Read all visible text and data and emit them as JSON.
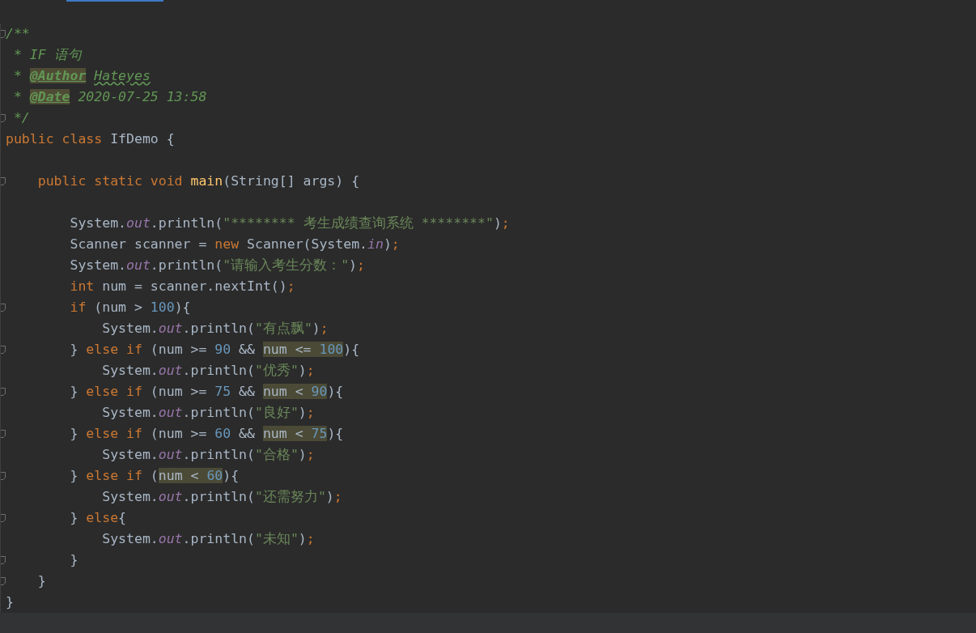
{
  "editor": {
    "lines": [
      {
        "fold": true,
        "tokens": [
          {
            "kind": "comment",
            "text": "/**"
          }
        ]
      },
      {
        "fold": false,
        "tokens": [
          {
            "kind": "comment",
            "text": " * IF 语句"
          }
        ]
      },
      {
        "fold": false,
        "tokens": [
          {
            "kind": "comment",
            "text": " * "
          },
          {
            "kind": "doc-tag",
            "text": "@Author"
          },
          {
            "kind": "doc-name",
            "text": "Hateyes"
          }
        ]
      },
      {
        "fold": false,
        "tokens": [
          {
            "kind": "comment",
            "text": " * "
          },
          {
            "kind": "doc-tag",
            "text": "@Date"
          },
          {
            "kind": "comment",
            "text": " 2020-07-25 13:58"
          }
        ]
      },
      {
        "fold": true,
        "tokens": [
          {
            "kind": "comment",
            "text": " */"
          }
        ]
      },
      {
        "fold": false,
        "tokens": [
          {
            "kind": "keyword",
            "text": "public class "
          },
          {
            "kind": "plain",
            "text": "IfDemo {"
          }
        ]
      },
      {
        "fold": false
      },
      {
        "fold": true,
        "tokens": [
          {
            "kind": "keyword",
            "text": "    public static void "
          },
          {
            "kind": "method",
            "text": "main"
          },
          {
            "kind": "plain",
            "text": "(String[] args) {"
          }
        ]
      },
      {
        "fold": false
      },
      {
        "fold": false,
        "tokens": [
          {
            "kind": "plain",
            "text": "        System."
          },
          {
            "kind": "field",
            "text": "out"
          },
          {
            "kind": "plain",
            "text": ".println("
          },
          {
            "kind": "string",
            "text": "\"******** 考生成绩查询系统 ********\""
          },
          {
            "kind": "plain",
            "text": ")"
          },
          {
            "kind": "semicolon",
            "text": ";"
          }
        ]
      },
      {
        "fold": false,
        "tokens": [
          {
            "kind": "plain",
            "text": "        Scanner scanner = "
          },
          {
            "kind": "keyword",
            "text": "new "
          },
          {
            "kind": "plain",
            "text": "Scanner(System."
          },
          {
            "kind": "field",
            "text": "in"
          },
          {
            "kind": "plain",
            "text": ")"
          },
          {
            "kind": "semicolon",
            "text": ";"
          }
        ]
      },
      {
        "fold": false,
        "tokens": [
          {
            "kind": "plain",
            "text": "        System."
          },
          {
            "kind": "field",
            "text": "out"
          },
          {
            "kind": "plain",
            "text": ".println("
          },
          {
            "kind": "string",
            "text": "\"请输入考生分数：\""
          },
          {
            "kind": "plain",
            "text": ")"
          },
          {
            "kind": "semicolon",
            "text": ";"
          }
        ]
      },
      {
        "fold": false,
        "tokens": [
          {
            "kind": "keyword",
            "text": "        int "
          },
          {
            "kind": "plain",
            "text": "num = scanner.nextInt()"
          },
          {
            "kind": "semicolon",
            "text": ";"
          }
        ]
      },
      {
        "fold": true,
        "tokens": [
          {
            "kind": "keyword",
            "text": "        if "
          },
          {
            "kind": "plain",
            "text": "(num > "
          },
          {
            "kind": "number",
            "text": "100"
          },
          {
            "kind": "plain",
            "text": "){"
          }
        ]
      },
      {
        "fold": false,
        "tokens": [
          {
            "kind": "plain",
            "text": "            System."
          },
          {
            "kind": "field",
            "text": "out"
          },
          {
            "kind": "plain",
            "text": ".println("
          },
          {
            "kind": "string",
            "text": "\"有点飘\""
          },
          {
            "kind": "plain",
            "text": ")"
          },
          {
            "kind": "semicolon",
            "text": ";"
          }
        ]
      },
      {
        "fold": true,
        "tokens": [
          {
            "kind": "plain",
            "text": "        } "
          },
          {
            "kind": "keyword",
            "text": "else if "
          },
          {
            "kind": "plain",
            "text": "(num >= "
          },
          {
            "kind": "number",
            "text": "90"
          },
          {
            "kind": "plain",
            "text": " && "
          },
          {
            "kind": "match",
            "tokens": [
              {
                "kind": "plain",
                "text": "num <= "
              },
              {
                "kind": "number",
                "text": "100"
              }
            ]
          },
          {
            "kind": "plain",
            "text": "){"
          }
        ]
      },
      {
        "fold": false,
        "tokens": [
          {
            "kind": "plain",
            "text": "            System."
          },
          {
            "kind": "field",
            "text": "out"
          },
          {
            "kind": "plain",
            "text": ".println("
          },
          {
            "kind": "string",
            "text": "\"优秀\""
          },
          {
            "kind": "plain",
            "text": ")"
          },
          {
            "kind": "semicolon",
            "text": ";"
          }
        ]
      },
      {
        "fold": true,
        "tokens": [
          {
            "kind": "plain",
            "text": "        } "
          },
          {
            "kind": "keyword",
            "text": "else if "
          },
          {
            "kind": "plain",
            "text": "(num >= "
          },
          {
            "kind": "number",
            "text": "75"
          },
          {
            "kind": "plain",
            "text": " && "
          },
          {
            "kind": "match",
            "tokens": [
              {
                "kind": "plain",
                "text": "num < "
              },
              {
                "kind": "number",
                "text": "90"
              }
            ]
          },
          {
            "kind": "plain",
            "text": "){"
          }
        ]
      },
      {
        "fold": false,
        "tokens": [
          {
            "kind": "plain",
            "text": "            System."
          },
          {
            "kind": "field",
            "text": "out"
          },
          {
            "kind": "plain",
            "text": ".println("
          },
          {
            "kind": "string",
            "text": "\"良好\""
          },
          {
            "kind": "plain",
            "text": ")"
          },
          {
            "kind": "semicolon",
            "text": ";"
          }
        ]
      },
      {
        "fold": true,
        "tokens": [
          {
            "kind": "plain",
            "text": "        } "
          },
          {
            "kind": "keyword",
            "text": "else if "
          },
          {
            "kind": "plain",
            "text": "(num >= "
          },
          {
            "kind": "number",
            "text": "60"
          },
          {
            "kind": "plain",
            "text": " && "
          },
          {
            "kind": "match",
            "tokens": [
              {
                "kind": "plain",
                "text": "num < "
              },
              {
                "kind": "number",
                "text": "75"
              }
            ]
          },
          {
            "kind": "plain",
            "text": "){"
          }
        ]
      },
      {
        "fold": false,
        "tokens": [
          {
            "kind": "plain",
            "text": "            System."
          },
          {
            "kind": "field",
            "text": "out"
          },
          {
            "kind": "plain",
            "text": ".println("
          },
          {
            "kind": "string",
            "text": "\"合格\""
          },
          {
            "kind": "plain",
            "text": ")"
          },
          {
            "kind": "semicolon",
            "text": ";"
          }
        ]
      },
      {
        "fold": true,
        "tokens": [
          {
            "kind": "plain",
            "text": "        } "
          },
          {
            "kind": "keyword",
            "text": "else if "
          },
          {
            "kind": "plain",
            "text": "("
          },
          {
            "kind": "match",
            "tokens": [
              {
                "kind": "plain",
                "text": "num < "
              },
              {
                "kind": "number",
                "text": "60"
              }
            ]
          },
          {
            "kind": "plain",
            "text": "){"
          }
        ]
      },
      {
        "fold": false,
        "tokens": [
          {
            "kind": "plain",
            "text": "            System."
          },
          {
            "kind": "field",
            "text": "out"
          },
          {
            "kind": "plain",
            "text": ".println("
          },
          {
            "kind": "string",
            "text": "\"还需努力\""
          },
          {
            "kind": "plain",
            "text": ")"
          },
          {
            "kind": "semicolon",
            "text": ";"
          }
        ]
      },
      {
        "fold": true,
        "tokens": [
          {
            "kind": "plain",
            "text": "        } "
          },
          {
            "kind": "keyword",
            "text": "else"
          },
          {
            "kind": "plain",
            "text": "{"
          }
        ]
      },
      {
        "fold": false,
        "tokens": [
          {
            "kind": "plain",
            "text": "            System."
          },
          {
            "kind": "field",
            "text": "out"
          },
          {
            "kind": "plain",
            "text": ".println("
          },
          {
            "kind": "string",
            "text": "\"未知\""
          },
          {
            "kind": "plain",
            "text": ")"
          },
          {
            "kind": "semicolon",
            "text": ";"
          }
        ]
      },
      {
        "fold": true,
        "tokens": [
          {
            "kind": "plain",
            "text": "        }"
          }
        ]
      },
      {
        "fold": true,
        "tokens": [
          {
            "kind": "plain",
            "text": "    }"
          }
        ]
      },
      {
        "fold": false,
        "tokens": [
          {
            "kind": "plain",
            "text": "}"
          }
        ]
      }
    ]
  }
}
